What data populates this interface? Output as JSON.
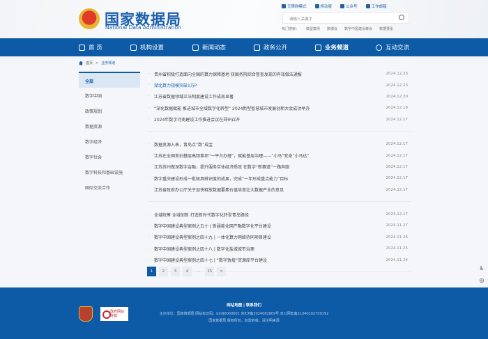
{
  "header": {
    "title_cn": "国家数据局",
    "title_en": "National Data Administration",
    "top_links": [
      "无障碍模式",
      "移动版",
      "公众号",
      "工作邮箱"
    ],
    "search_placeholder": "请输入关键字",
    "hot_label": "热门搜索：",
    "hot_terms": [
      "典型案例",
      "数博会",
      "数字中国建设峰会",
      "数据要素"
    ]
  },
  "nav": [
    "首 页",
    "机构设置",
    "新闻动态",
    "政务公开",
    "业务频道",
    "互动交流"
  ],
  "breadcrumb": [
    "首页",
    ">",
    "业务频道"
  ],
  "sidebar": [
    "全部",
    "数字中国",
    "政策规划",
    "数据资源",
    "数字经济",
    "数字社会",
    "数字科技和基础设施",
    "国际交流合作"
  ],
  "groups": [
    [
      {
        "title": "贵州省积极打造面向全国的算力保障基地 获国务院综合督查发现的有效做法通报",
        "date": "2024.12.23"
      },
      {
        "title": "湖北算力规模突破1万P",
        "date": "2024.12.23"
      },
      {
        "title": "江苏省数据领域立法制度建设工作成效显著",
        "date": "2024.12.20"
      },
      {
        "title": "“深化数据赋能 推进城市全域数字化转型” 2024新型智慧城市发展创新大会成功举办",
        "date": "2024.12.18"
      },
      {
        "title": "2024年数字河南建设工作推进会议在郑州召开",
        "date": "2024.12.17"
      }
    ],
    [
      {
        "title": "数据资源入表，青岛点“数”成金",
        "date": "2024.12.17"
      },
      {
        "title": "江苏在全国首创基层高频事项“一平台办理”，赋能基层治理——“小马”变身“小马达”",
        "date": "2024.12.17"
      },
      {
        "title": "江苏苏州做深数字金融，提升服务实体经济质效 在数字“新赛道”一路奔跑",
        "date": "2024.12.17"
      },
      {
        "title": "数字重庆建设形成一批极具辨识度的成果，完成“一年形成重点能力”目标",
        "date": "2024.12.17"
      },
      {
        "title": "江苏省政府办公厅关于加快释放数据要素价值培育壮大数据产业的意见",
        "date": "2024.12.17"
      }
    ],
    [
      {
        "title": "全域统筹 全域创新 打造新时代数字化转型青岛路径",
        "date": "2024.12.17"
      },
      {
        "title": "数字中国建设典型案例之五十 | 新疆能化网产融数字化平台建设",
        "date": "2024.11.27"
      },
      {
        "title": "数字中国建设典型案例之四十九 | 一体化算力网络协同项目建设",
        "date": "2024.11.26"
      },
      {
        "title": "数字中国建设典型案例之四十八 | 数字化盐城城市治理",
        "date": "2024.11.25"
      },
      {
        "title": "数字中国建设典型案例之四十七 | “数字敦煌”资源库平台建设",
        "date": "2024.11.24"
      }
    ]
  ],
  "pagination": [
    "1",
    "2",
    "3",
    "4",
    "...",
    "15",
    ">"
  ],
  "footer": {
    "links": "网站地图 | 联系我们",
    "line1": "主办单位：国家数据局 网站标识码：bm90000001 京ICP备2024082809号  京公网安备11040102700192",
    "line2": "国家数据局 版权所有，如需转载，请注明来源",
    "badge2": "政府网站 找错"
  },
  "colors": {
    "brand": "#0d5aa7"
  }
}
